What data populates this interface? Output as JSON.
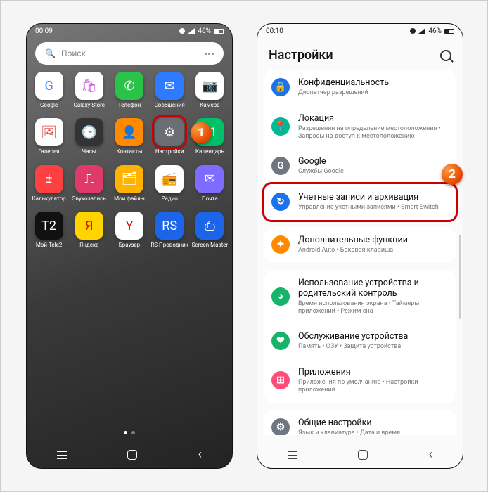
{
  "callouts": {
    "c1": "1",
    "c2": "2"
  },
  "left": {
    "status": {
      "time": "00:09",
      "battery": "46%"
    },
    "search_placeholder": "Поиск",
    "apps": [
      {
        "name": "google",
        "label": "Google",
        "bg": "#ffffff",
        "glyph": "G",
        "gcolor": "#4285F4"
      },
      {
        "name": "galaxy-store",
        "label": "Galaxy Store",
        "bg": "#ffffff",
        "glyph": "🛍",
        "gcolor": "#c04fd6"
      },
      {
        "name": "phone",
        "label": "Телефон",
        "bg": "#2bc24a",
        "glyph": "✆"
      },
      {
        "name": "messages",
        "label": "Сообщения",
        "bg": "#2e7bff",
        "glyph": "✉"
      },
      {
        "name": "camera",
        "label": "Камера",
        "bg": "#ffffff",
        "glyph": "📷",
        "gcolor": "#222"
      },
      {
        "name": "gallery",
        "label": "Галерея",
        "bg": "#ffffff",
        "glyph": "🖼",
        "gcolor": "#e04040"
      },
      {
        "name": "clock",
        "label": "Часы",
        "bg": "#333333",
        "glyph": "🕒"
      },
      {
        "name": "contacts",
        "label": "Контакты",
        "bg": "#ff8a00",
        "glyph": "👤"
      },
      {
        "name": "settings",
        "label": "Настройки",
        "bg": "#6b6f75",
        "glyph": "⚙",
        "highlight": true
      },
      {
        "name": "calendar",
        "label": "Календарь",
        "bg": "#00c06a",
        "glyph": "21"
      },
      {
        "name": "calculator",
        "label": "Калькулятор",
        "bg": "#ff4040",
        "glyph": "±"
      },
      {
        "name": "voice-rec",
        "label": "Звукозапись",
        "bg": "#e03a6a",
        "glyph": "⎍"
      },
      {
        "name": "my-files",
        "label": "Мои файлы",
        "bg": "#ffb300",
        "glyph": "🗂"
      },
      {
        "name": "radio",
        "label": "Радио",
        "bg": "#ffffff",
        "glyph": "📻",
        "gcolor": "#d14"
      },
      {
        "name": "mail",
        "label": "Почта",
        "bg": "#7e6bff",
        "glyph": "✉"
      },
      {
        "name": "tele2",
        "label": "Мой Tele2",
        "bg": "#111111",
        "glyph": "T2"
      },
      {
        "name": "yandex",
        "label": "Яндекс",
        "bg": "#ffd400",
        "glyph": "Я",
        "gcolor": "#d00"
      },
      {
        "name": "browser",
        "label": "Браузер",
        "bg": "#ffffff",
        "glyph": "Y",
        "gcolor": "#d00"
      },
      {
        "name": "rs-explorer",
        "label": "RS Проводник",
        "bg": "#1c64e8",
        "glyph": "RS"
      },
      {
        "name": "screen-master",
        "label": "Screen Master",
        "bg": "#1c64e8",
        "glyph": "⎙"
      }
    ]
  },
  "right": {
    "status": {
      "time": "00:10",
      "battery": "46%"
    },
    "header": "Настройки",
    "groups": [
      [
        {
          "key": "privacy",
          "title": "Конфиденциальность",
          "desc": "Диспетчер разрешений",
          "color": "#1a73e8",
          "glyph": "🔒"
        },
        {
          "key": "location",
          "title": "Локация",
          "desc": "Разрешения на определение местоположения • Запросы на доступ к местоположению",
          "color": "#00b893",
          "glyph": "📍"
        },
        {
          "key": "google",
          "title": "Google",
          "desc": "Службы Google",
          "color": "#6f7680",
          "glyph": "G"
        },
        {
          "key": "accounts",
          "title": "Учетные записи и архивация",
          "desc": "Управление учетными записями • Smart Switch",
          "color": "#1a73e8",
          "glyph": "↻",
          "highlight": true
        }
      ],
      [
        {
          "key": "advanced",
          "title": "Дополнительные функции",
          "desc": "Android Auto • Боковая клавиша",
          "color": "#ff8a00",
          "glyph": "✦"
        }
      ],
      [
        {
          "key": "wellbeing",
          "title": "Использование устройства и родительский контроль",
          "desc": "Время использования экрана • Таймеры приложений • Режим сна",
          "color": "#18b36a",
          "glyph": "◕"
        },
        {
          "key": "care",
          "title": "Обслуживание устройства",
          "desc": "Память • ОЗУ • Защита устройства",
          "color": "#18b36a",
          "glyph": "❤"
        },
        {
          "key": "apps",
          "title": "Приложения",
          "desc": "Приложения по умолчанию • Настройки приложений",
          "color": "#ff4e7a",
          "glyph": "⊞"
        }
      ],
      [
        {
          "key": "general",
          "title": "Общие настройки",
          "desc": "Язык и клавиатура • Дата и время",
          "color": "#6f7680",
          "glyph": "⚙"
        }
      ]
    ]
  }
}
